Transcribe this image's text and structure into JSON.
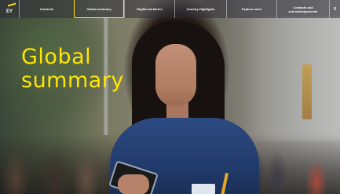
{
  "brand": {
    "logo_text": "EY",
    "accent_color": "#ffe600",
    "nav_background": "#2e2e38"
  },
  "nav": {
    "items": [
      {
        "label": "Contents",
        "active": false
      },
      {
        "label": "Global summary",
        "active": true
      },
      {
        "label": "Digital workforce",
        "active": false
      },
      {
        "label": "Country Highlights",
        "active": false
      },
      {
        "label": "Explore more",
        "active": false
      },
      {
        "label": "Contacts and acknowledgements",
        "active": false
      }
    ],
    "close_label": "X"
  },
  "hero": {
    "headline_line1": "Global",
    "headline_line2": "summary",
    "headline_color": "#ffe600"
  }
}
